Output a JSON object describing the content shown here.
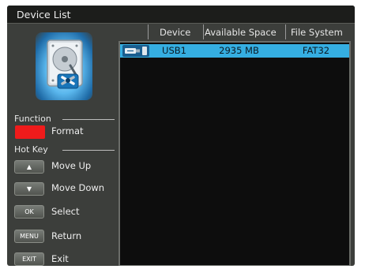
{
  "window": {
    "title": "Device List"
  },
  "table": {
    "headers": [
      "Device",
      "Available Space",
      "File System"
    ],
    "rows": [
      {
        "device": "USB1",
        "space": "2935 MB",
        "fs": "FAT32",
        "icon": "usb-drive-icon"
      }
    ]
  },
  "function": {
    "label": "Function",
    "items": [
      {
        "color": "#ef1b1b",
        "label": "Format"
      }
    ]
  },
  "hotkeys": {
    "label": "Hot Key",
    "items": [
      {
        "key": "▲",
        "label": "Move Up"
      },
      {
        "key": "▼",
        "label": "Move Down"
      },
      {
        "key": "OK",
        "label": "Select"
      },
      {
        "key": "MENU",
        "label": "Return"
      },
      {
        "key": "EXIT",
        "label": "Exit"
      }
    ]
  },
  "icons": [
    "hard-drive-icon",
    "usb-drive-icon"
  ],
  "colors": {
    "selection": "#35aee1",
    "red_key": "#ef1b1b"
  }
}
